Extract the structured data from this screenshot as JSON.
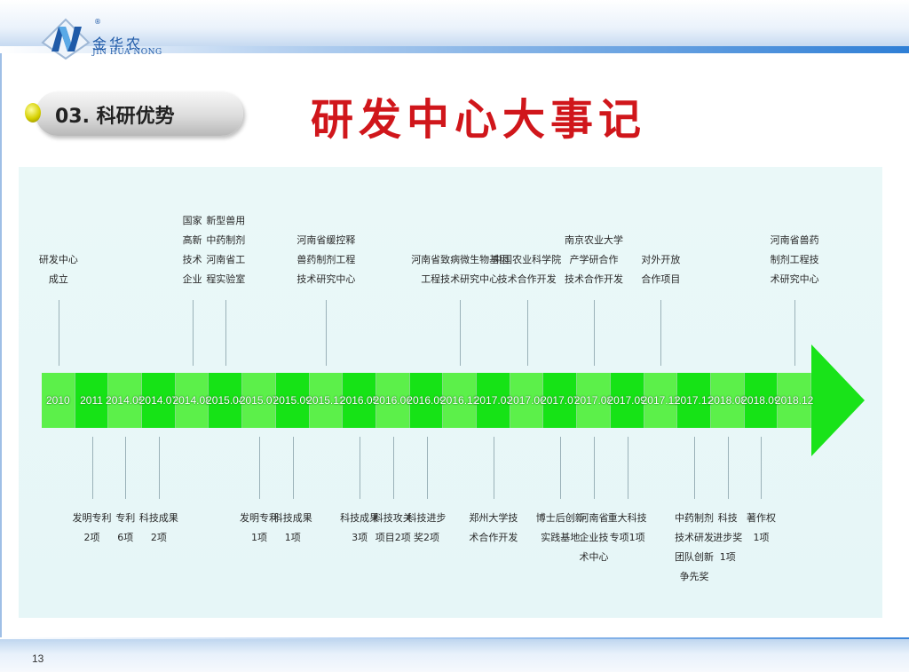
{
  "logo": {
    "cn": "金华农",
    "en": "JIN HUA NONG",
    "reg": "®"
  },
  "section": {
    "label": "03. 科研优势"
  },
  "headline": "研发中心大事记",
  "page_number": "13",
  "timeline": {
    "years": [
      "2010",
      "2011",
      "2014.05",
      "2014.07",
      "2014.08",
      "2015.04",
      "2015.07",
      "2015.09",
      "2015.12",
      "2016.05",
      "2016.06",
      "2016.09",
      "2016.12",
      "2017.03",
      "2017.06",
      "2017.07",
      "2017.08",
      "2017.09",
      "2017.11",
      "2017.12",
      "2018.08",
      "2018.09",
      "2018.12"
    ],
    "top_events": [
      {
        "seg": 0,
        "text": "研发中心\n成立"
      },
      {
        "seg": 4,
        "text": "国家\n高新\n技术\n企业"
      },
      {
        "seg": 5,
        "text": "新型兽用\n中药制剂\n河南省工\n程实验室"
      },
      {
        "seg": 8,
        "text": "河南省缓控释\n兽药制剂工程\n技术研究中心"
      },
      {
        "seg": 12,
        "text": "河南省致病微生物基因\n工程技术研究中心"
      },
      {
        "seg": 14,
        "text": "中国农业科学院\n技术合作开发"
      },
      {
        "seg": 16,
        "text": "南京农业大学\n产学研合作\n技术合作开发"
      },
      {
        "seg": 18,
        "text": "对外开放\n合作项目"
      },
      {
        "seg": 22,
        "text": "河南省兽药\n制剂工程技\n术研究中心"
      }
    ],
    "bottom_events": [
      {
        "seg": 1,
        "text": "发明专利\n2项"
      },
      {
        "seg": 2,
        "text": "专利\n6项"
      },
      {
        "seg": 3,
        "text": "科技成果\n2项"
      },
      {
        "seg": 6,
        "text": "发明专利\n1项"
      },
      {
        "seg": 7,
        "text": "科技成果\n1项"
      },
      {
        "seg": 9,
        "text": "科技成果\n3项"
      },
      {
        "seg": 10,
        "text": "科技攻关\n项目2项"
      },
      {
        "seg": 11,
        "text": "科技进步\n奖2项"
      },
      {
        "seg": 13,
        "text": "郑州大学技\n术合作开发"
      },
      {
        "seg": 15,
        "text": "博士后创新\n实践基地"
      },
      {
        "seg": 16,
        "text": "河南省\n企业技\n术中心"
      },
      {
        "seg": 17,
        "text": "重大科技\n专项1项"
      },
      {
        "seg": 19,
        "text": "中药制剂\n技术研发\n团队创新\n争先奖"
      },
      {
        "seg": 20,
        "text": "科技\n进步奖\n1项"
      },
      {
        "seg": 21,
        "text": "著作权\n1项"
      }
    ]
  },
  "colors": {
    "headline": "#d0161b",
    "bar_light": "#5cf04a",
    "bar_dark": "#16e316",
    "panel": "#e8f7f7"
  }
}
